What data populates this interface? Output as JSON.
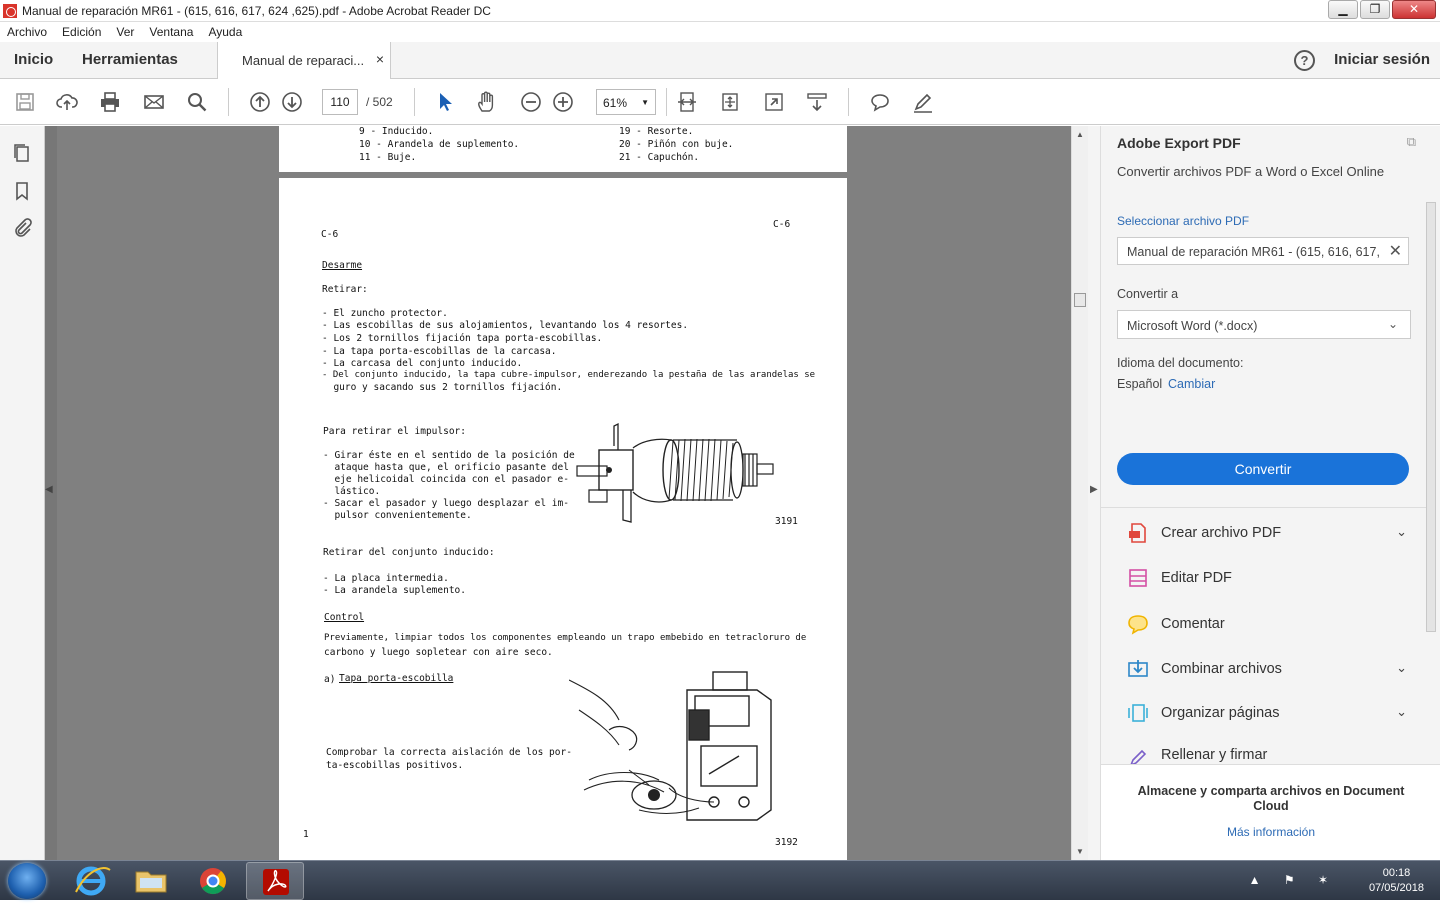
{
  "window": {
    "title": "Manual de reparación MR61 - (615, 616, 617, 624 ,625).pdf - Adobe Acrobat Reader DC",
    "min": "▁",
    "max": "❐",
    "close": "✕"
  },
  "menu": [
    "Archivo",
    "Edición",
    "Ver",
    "Ventana",
    "Ayuda"
  ],
  "tabs": {
    "home": "Inicio",
    "tools": "Herramientas",
    "document": "Manual de reparaci...",
    "close": "×",
    "help": "?",
    "signin": "Iniciar sesión"
  },
  "toolbar": {
    "page_current": "110",
    "page_total": "/  502",
    "zoom": "61%",
    "zoom_arrow": "▼"
  },
  "icons": [
    "save-icon",
    "upload-icon",
    "print-icon",
    "mail-icon",
    "search-icon",
    "page-up-icon",
    "page-down-icon",
    "select-arrow-icon",
    "hand-icon",
    "zoom-out-icon",
    "zoom-in-icon",
    "page-fit-icon",
    "full-screen-icon",
    "comment-icon",
    "highlight-pen-icon"
  ],
  "viewer": {
    "collapse_left": "◀",
    "collapse_right": "▶"
  },
  "document": {
    "prev_page_lines": [
      {
        "left": "9  - Inducido.",
        "right": "19  - Resorte."
      },
      {
        "left": "10 - Arandela de suplemento.",
        "right": "20  - Piñón con buje."
      },
      {
        "left": "11 - Buje.",
        "right": "21  - Capuchón."
      }
    ],
    "header_left": "C-6",
    "header_right": "C-6",
    "section_desarme": "Desarme",
    "retirar": "Retirar:",
    "retirar_items": [
      "- El zuncho protector.",
      "- Las escobillas de sus alojamientos, levantando los 4 resortes.",
      "- Los 2 tornillos fijación tapa porta-escobillas.",
      "- La tapa porta-escobillas de la carcasa.",
      "- La carcasa del conjunto inducido.",
      "- Del conjunto inducido, la tapa cubre-impulsor, enderezando la pestaña de las arandelas se",
      "  guro y sacando sus 2 tornillos fijación."
    ],
    "impulsor_title": "Para retirar el impulsor:",
    "impulsor_items": [
      "- Girar éste en el sentido de la posición de",
      "  ataque hasta que, el orificio pasante del",
      "  eje helicoidal coincida con el pasador e-",
      "  lástico.",
      "- Sacar el pasador y luego desplazar el im-",
      "  pulsor convenientemente."
    ],
    "fig1_num": "3191",
    "inducido_title": "Retirar del conjunto inducido:",
    "inducido_items": [
      "- La placa intermedia.",
      "- La arandela suplemento."
    ],
    "section_control": "Control",
    "control_text": [
      "Previamente, limpiar todos los componentes empleando un trapo embebido en tetracloruro de",
      "carbono y luego sopletear con aire seco."
    ],
    "tapa_title_prefix": "a)",
    "tapa_title": "Tapa porta-escobilla",
    "tapa_text": [
      "Comprobar la correcta aislación de los por-",
      "ta-escobillas positivos."
    ],
    "fig2_num": "3192",
    "page_mark": "1"
  },
  "right_panel": {
    "title": "Adobe Export PDF",
    "subtitle": "Convertir archivos PDF a Word o Excel Online",
    "select_label": "Seleccionar archivo PDF",
    "file_value": "Manual de reparación MR61 - (615, 616, 617,",
    "file_clear": "✕",
    "convert_to_label": "Convertir a",
    "format_value": "Microsoft Word (*.docx)",
    "format_chevron": "⌄",
    "language_label": "Idioma del documento:",
    "language_value": "Español",
    "language_change": "Cambiar",
    "convert_button": "Convertir",
    "tools": [
      {
        "label": "Crear archivo PDF",
        "expand": "⌄",
        "color": "#e0473c"
      },
      {
        "label": "Editar PDF",
        "expand": "",
        "color": "#d44fa4"
      },
      {
        "label": "Comentar",
        "expand": "",
        "color": "#f0b400"
      },
      {
        "label": "Combinar archivos",
        "expand": "⌄",
        "color": "#2d87c8"
      },
      {
        "label": "Organizar páginas",
        "expand": "⌄",
        "color": "#3bb0d8"
      },
      {
        "label": "Rellenar y firmar",
        "expand": "",
        "color": "#7a5fc9"
      }
    ],
    "store_text": "Almacene y comparta archivos en Document Cloud",
    "more_info": "Más información"
  },
  "taskbar": {
    "time": "00:18",
    "date": "07/05/2018",
    "tray": "▲ ⚑ ✶"
  }
}
